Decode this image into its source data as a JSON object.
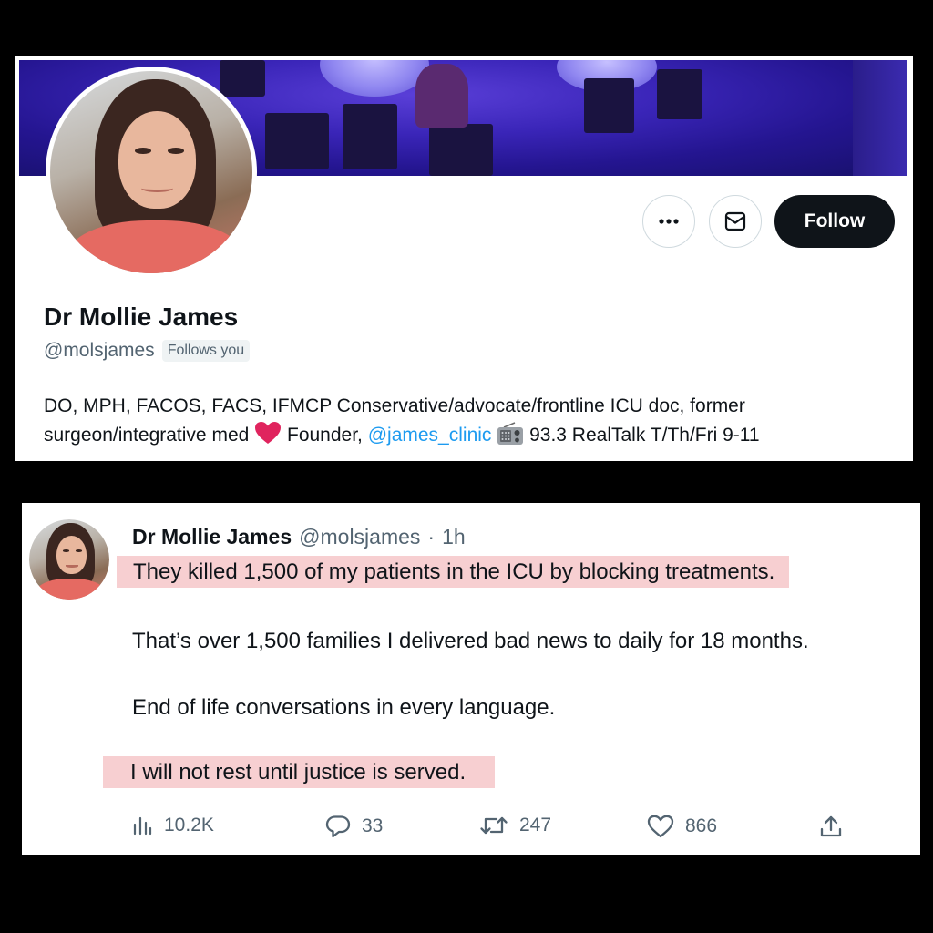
{
  "profile": {
    "display_name": "Dr Mollie James",
    "handle": "@molsjames",
    "follows_you_badge": "Follows you",
    "follow_button": "Follow",
    "bio": {
      "part1": "DO, MPH, FACOS, FACS, IFMCP Conservative/advocate/frontline ICU doc, former surgeon/integrative med",
      "part2": " Founder, ",
      "mention": "@james_clinic",
      "part3": " 93.3 RealTalk T/Th/Fri 9-11"
    },
    "icons": {
      "more": "more-icon",
      "message": "envelope-icon",
      "heart": "red-heart-emoji",
      "radio": "radio-emoji"
    }
  },
  "tweet": {
    "name": "Dr Mollie James",
    "handle": "@molsjames",
    "separator": "·",
    "time": "1h",
    "lines": [
      "They killed 1,500 of my patients in the ICU by blocking treatments.",
      "That’s over 1,500 families I delivered bad news to daily for 18 months.",
      "End of life conversations in every language.",
      "I will not rest until justice is served."
    ],
    "highlight_color": "#f7cfd1",
    "stats": {
      "views": "10.2K",
      "replies": "33",
      "retweets": "247",
      "likes": "866"
    }
  },
  "colors": {
    "accent": "#1d9bf0",
    "text_primary": "#0f1419",
    "text_secondary": "#536471",
    "heart": "#e0245e"
  }
}
